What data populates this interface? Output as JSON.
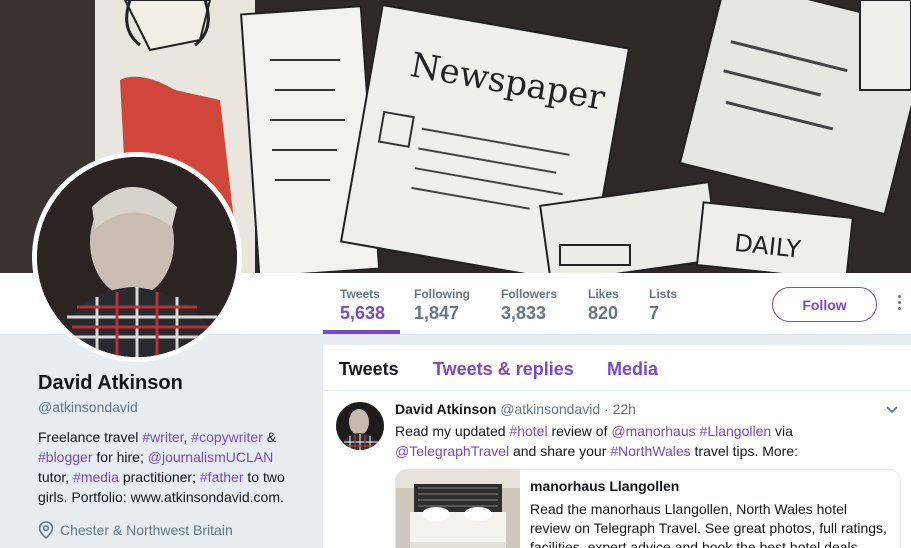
{
  "profile": {
    "name": "David Atkinson",
    "handle": "@atkinsondavid",
    "bio": {
      "t1": "Freelance travel ",
      "h_writer": "#writer",
      "t2": ", ",
      "h_copywriter": "#copywriter",
      "t3": " & ",
      "h_blogger": "#blogger",
      "t4": " for hire; ",
      "m_journalism": "@journalismUCLAN",
      "t5": " tutor, ",
      "h_media": "#media",
      "t6": " practitioner; ",
      "h_father": "#father",
      "t7": " to two girls. Portfolio: www.atkinsondavid.com."
    },
    "location": "Chester & Northwest Britain",
    "location_icon": "map-pin-icon"
  },
  "stats": [
    {
      "label": "Tweets",
      "value": "5,638"
    },
    {
      "label": "Following",
      "value": "1,847"
    },
    {
      "label": "Followers",
      "value": "3,833"
    },
    {
      "label": "Likes",
      "value": "820"
    },
    {
      "label": "Lists",
      "value": "7"
    }
  ],
  "follow_label": "Follow",
  "tabs": [
    {
      "label": "Tweets"
    },
    {
      "label": "Tweets & replies"
    },
    {
      "label": "Media"
    }
  ],
  "banner": {
    "newspaper_text": "Newspaper",
    "daily_text": "DAILY"
  },
  "tweet": {
    "name": "David Atkinson",
    "handle": "@atkinsondavid",
    "sep": " · ",
    "time": "22h",
    "text": {
      "t1": "Read my updated ",
      "h_hotel": "#hotel",
      "t2": " review of ",
      "m_manorhaus": "@manorhaus",
      "t3": " ",
      "h_llangollen": "#Llangollen",
      "t4": " via ",
      "m_telegraph": "@TelegraphTravel",
      "t5": " and share your ",
      "h_northwales": "#NorthWales",
      "t6": " travel tips. More:"
    },
    "card": {
      "title": "manorhaus Llangollen",
      "description": "Read the manorhaus Llangollen, North Wales hotel review on Telegraph Travel. See great photos, full ratings, facilities, expert advice and book the best hotel deals."
    }
  },
  "colors": {
    "accent": "#794bc4",
    "muted": "#657786",
    "text": "#14171a"
  }
}
